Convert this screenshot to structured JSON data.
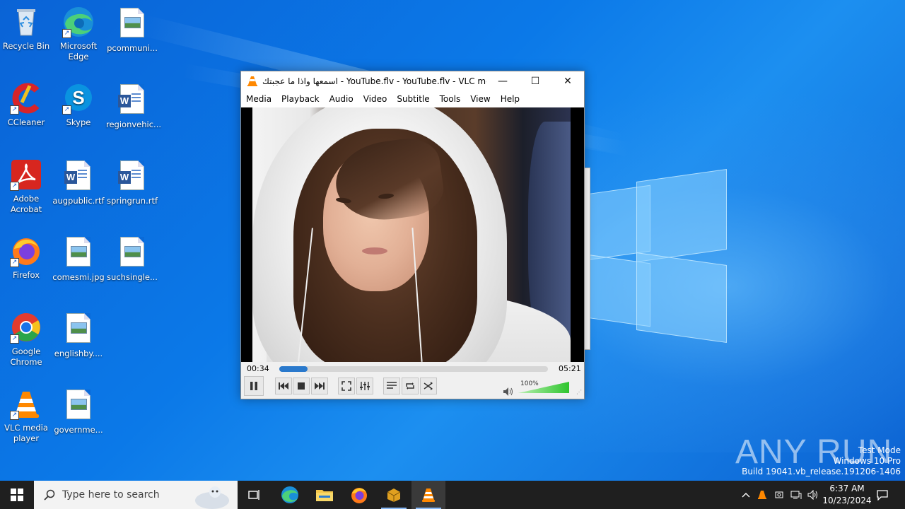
{
  "desktop": {
    "icons": [
      {
        "label": "Recycle Bin"
      },
      {
        "label": "Microsoft Edge"
      },
      {
        "label": "pcommuni..."
      },
      {
        "label": "CCleaner"
      },
      {
        "label": "Skype"
      },
      {
        "label": "regionvehic..."
      },
      {
        "label": "Adobe Acrobat"
      },
      {
        "label": "augpublic.rtf"
      },
      {
        "label": "springrun.rtf"
      },
      {
        "label": "Firefox"
      },
      {
        "label": "comesmi.jpg"
      },
      {
        "label": "suchsingle..."
      },
      {
        "label": "Google Chrome"
      },
      {
        "label": "englishby...."
      },
      {
        "label": "VLC media player"
      },
      {
        "label": "governme..."
      }
    ]
  },
  "vlc": {
    "title": "اسمعها واذا ما عجبتك - YouTube.flv - YouTube.flv - VLC me...",
    "menu": [
      "Media",
      "Playback",
      "Audio",
      "Video",
      "Subtitle",
      "Tools",
      "View",
      "Help"
    ],
    "elapsed": "00:34",
    "total": "05:21",
    "progress": 0.106,
    "volume_label": "100%",
    "volume": 1.0,
    "accent": "#2a79cc"
  },
  "watermark": {
    "brand": "ANY RUN",
    "line1": "Test Mode",
    "line2": "Windows 10 Pro",
    "line3": "Build 19041.vb_release.191206-1406"
  },
  "taskbar": {
    "search_placeholder": "Type here to search",
    "time": "6:37 AM",
    "date": "10/23/2024"
  }
}
